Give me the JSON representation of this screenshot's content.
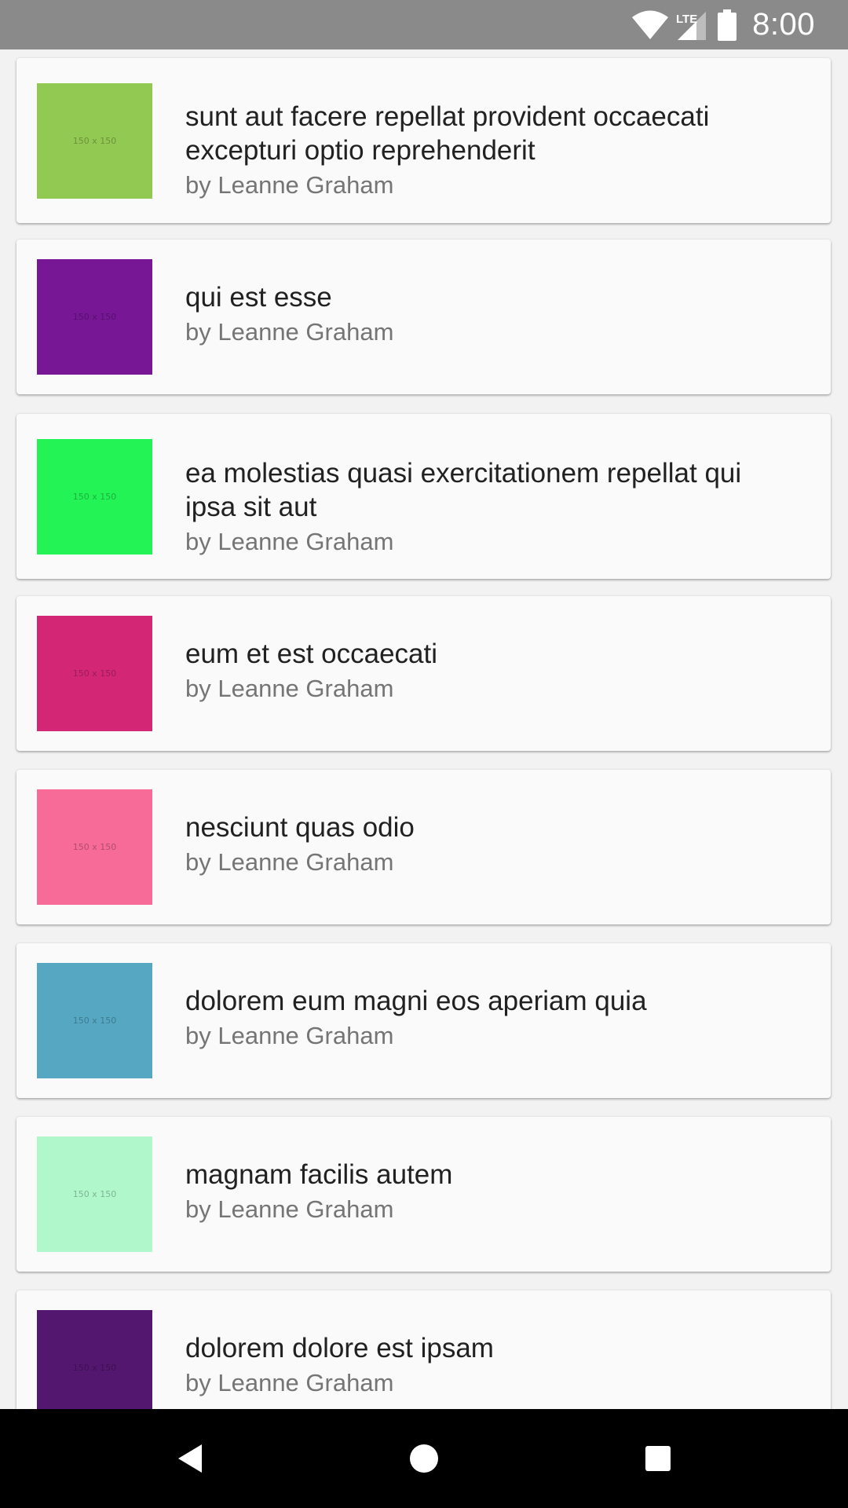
{
  "status_bar": {
    "time": "8:00",
    "network_label": "LTE",
    "icons": [
      "wifi-icon",
      "cellular-signal-icon",
      "battery-icon"
    ]
  },
  "colors": {
    "status_bar": "#8a8a8a",
    "card_background": "#fafafa",
    "title_text": "#212121",
    "author_text": "#757575",
    "nav_bar": "#000000"
  },
  "posts": [
    {
      "title": "sunt aut facere repellat provident occaecati excepturi optio reprehenderit",
      "author": "by Leanne Graham",
      "thumb_label": "150 x 150",
      "thumb_color": "#92c952"
    },
    {
      "title": "qui est esse",
      "author": "by Leanne Graham",
      "thumb_label": "150 x 150",
      "thumb_color": "#771796"
    },
    {
      "title": "ea molestias quasi exercitationem repellat qui ipsa sit aut",
      "author": "by Leanne Graham",
      "thumb_label": "150 x 150",
      "thumb_color": "#24f355"
    },
    {
      "title": "eum et est occaecati",
      "author": "by Leanne Graham",
      "thumb_label": "150 x 150",
      "thumb_color": "#d32776"
    },
    {
      "title": "nesciunt quas odio",
      "author": "by Leanne Graham",
      "thumb_label": "150 x 150",
      "thumb_color": "#f66b97"
    },
    {
      "title": "dolorem eum magni eos aperiam quia",
      "author": "by Leanne Graham",
      "thumb_label": "150 x 150",
      "thumb_color": "#56a8c2"
    },
    {
      "title": "magnam facilis autem",
      "author": "by Leanne Graham",
      "thumb_label": "150 x 150",
      "thumb_color": "#b0f7cc"
    },
    {
      "title": "dolorem dolore est ipsam",
      "author": "by Leanne Graham",
      "thumb_label": "150 x 150",
      "thumb_color": "#54176f"
    }
  ],
  "nav_bar": {
    "buttons": [
      "back-icon",
      "home-icon",
      "recents-icon"
    ]
  }
}
